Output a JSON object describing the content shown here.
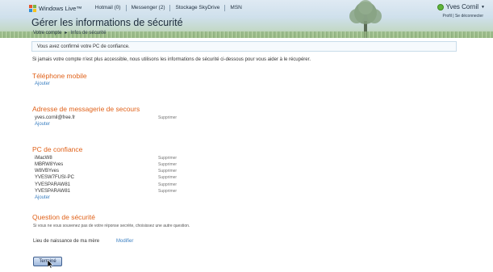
{
  "header": {
    "brand": "Windows Live™",
    "nav": [
      "Hotmail (0)",
      "Messenger (2)",
      "Stockage SkyDrive",
      "MSN"
    ],
    "user_name": "Yves Cornil",
    "user_links": "Profil  |  Se déconnecter",
    "page_title": "Gérer les informations de sécurité",
    "breadcrumb": {
      "parent": "Votre compte",
      "separator": "▸",
      "current": "Infos de sécurité"
    }
  },
  "notice": "Vous avez confirmé votre PC de confiance.",
  "intro": "Si jamais votre compte n'est plus accessible, nous utilisons les informations de sécurité ci-dessous pour vous aider à le récupérer.",
  "mobile": {
    "title": "Téléphone mobile",
    "add": "Ajouter"
  },
  "email": {
    "title": "Adresse de messagerie de secours",
    "items": [
      {
        "value": "yves.cornil@free.fr",
        "delete": "Supprimer"
      }
    ],
    "add": "Ajouter"
  },
  "pcs": {
    "title": "PC de confiance",
    "items": [
      {
        "name": "iMacW8",
        "delete": "Supprimer"
      },
      {
        "name": "MBRW8Yves",
        "delete": "Supprimer"
      },
      {
        "name": "W8VBYves",
        "delete": "Supprimer"
      },
      {
        "name": "YVESW7FUSI-PC",
        "delete": "Supprimer"
      },
      {
        "name": "YVESPARAW81",
        "delete": "Supprimer"
      },
      {
        "name": "YVESPARAW81",
        "delete": "Supprimer"
      }
    ],
    "add": "Ajouter"
  },
  "question": {
    "title": "Question de sécurité",
    "hint": "Si vous ne vous souvenez pas de votre réponse secrète, choisissez une autre question.",
    "label": "Lieu de naissance de ma mère",
    "modify": "Modifier"
  },
  "done_button": "Terminé",
  "colors": {
    "section_title": "#e0621a",
    "link": "#3a7fc1",
    "status": "#5fb33a"
  }
}
